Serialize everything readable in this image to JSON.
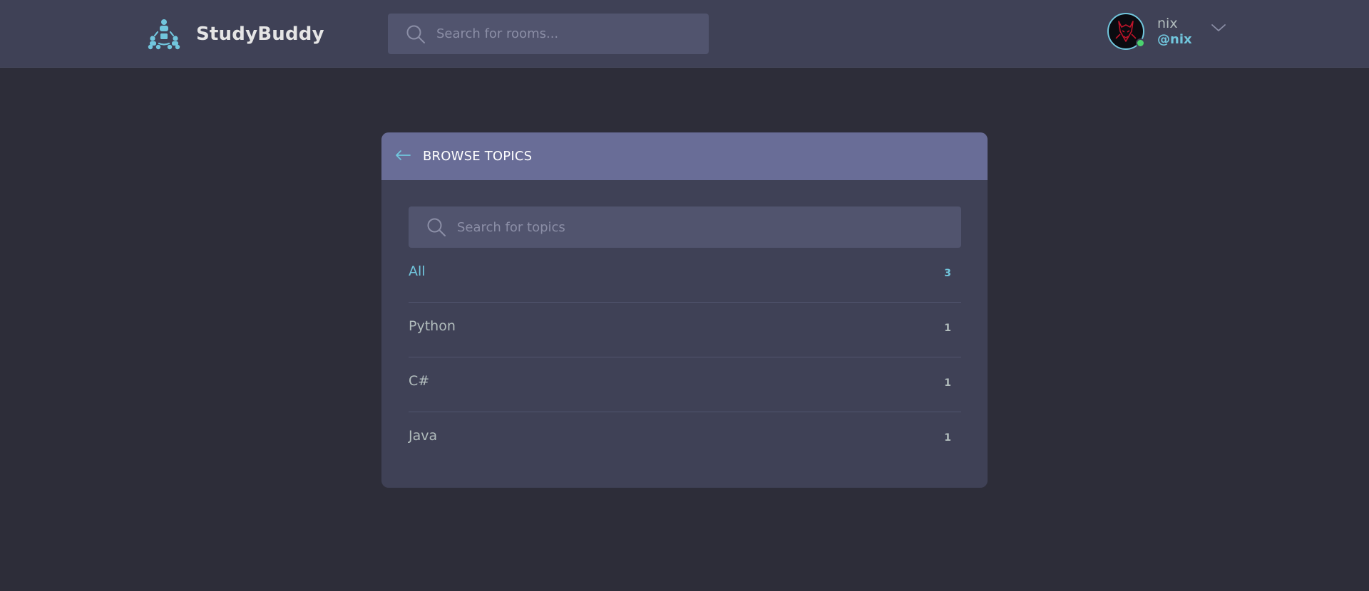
{
  "app": {
    "name": "StudyBuddy",
    "logo_icon": "people-group-icon",
    "accent_color": "#71c6dd"
  },
  "header": {
    "search": {
      "placeholder": "Search for rooms...",
      "value": "",
      "icon": "search-icon"
    },
    "user": {
      "name": "nix",
      "handle": "@nix",
      "status": "online",
      "status_color": "#4bd36f",
      "menu_icon": "chevron-down-icon"
    }
  },
  "topics_panel": {
    "title": "BROWSE TOPICS",
    "back_icon": "arrow-left-icon",
    "search": {
      "placeholder": "Search for topics",
      "value": "",
      "icon": "search-icon"
    },
    "items": [
      {
        "name": "All",
        "count": "3",
        "active": true
      },
      {
        "name": "Python",
        "count": "1",
        "active": false
      },
      {
        "name": "C#",
        "count": "1",
        "active": false
      },
      {
        "name": "Java",
        "count": "1",
        "active": false
      }
    ]
  }
}
